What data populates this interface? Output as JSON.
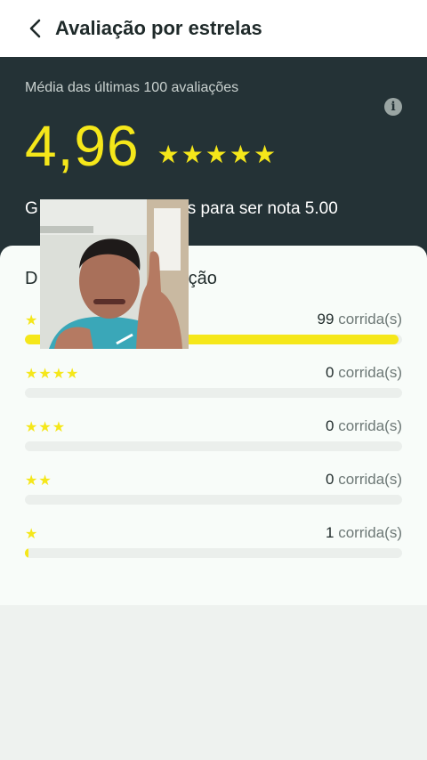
{
  "header": {
    "title": "Avaliação por estrelas",
    "back_icon": "chevron-left-icon"
  },
  "summary": {
    "subtitle": "Média das últimas 100 avaliações",
    "rating": "4,96",
    "stars": "★★★★★",
    "goal_text": "G",
    "goal_text_end": "s para ser nota 5.00",
    "info_icon": "info-icon"
  },
  "distribution": {
    "title_start": "D",
    "title_end": "ação",
    "unit": "corrida(s)",
    "rows": [
      {
        "stars": "★",
        "count": "99",
        "fraction": 0.99
      },
      {
        "stars": "★★★★",
        "count": "0",
        "fraction": 0
      },
      {
        "stars": "★★★",
        "count": "0",
        "fraction": 0
      },
      {
        "stars": "★★",
        "count": "0",
        "fraction": 0
      },
      {
        "stars": "★",
        "count": "1",
        "fraction": 0.01
      }
    ]
  },
  "colors": {
    "accent_yellow": "#f5e71a",
    "hero_background": "#243236",
    "card_background": "#f8fcf9"
  }
}
